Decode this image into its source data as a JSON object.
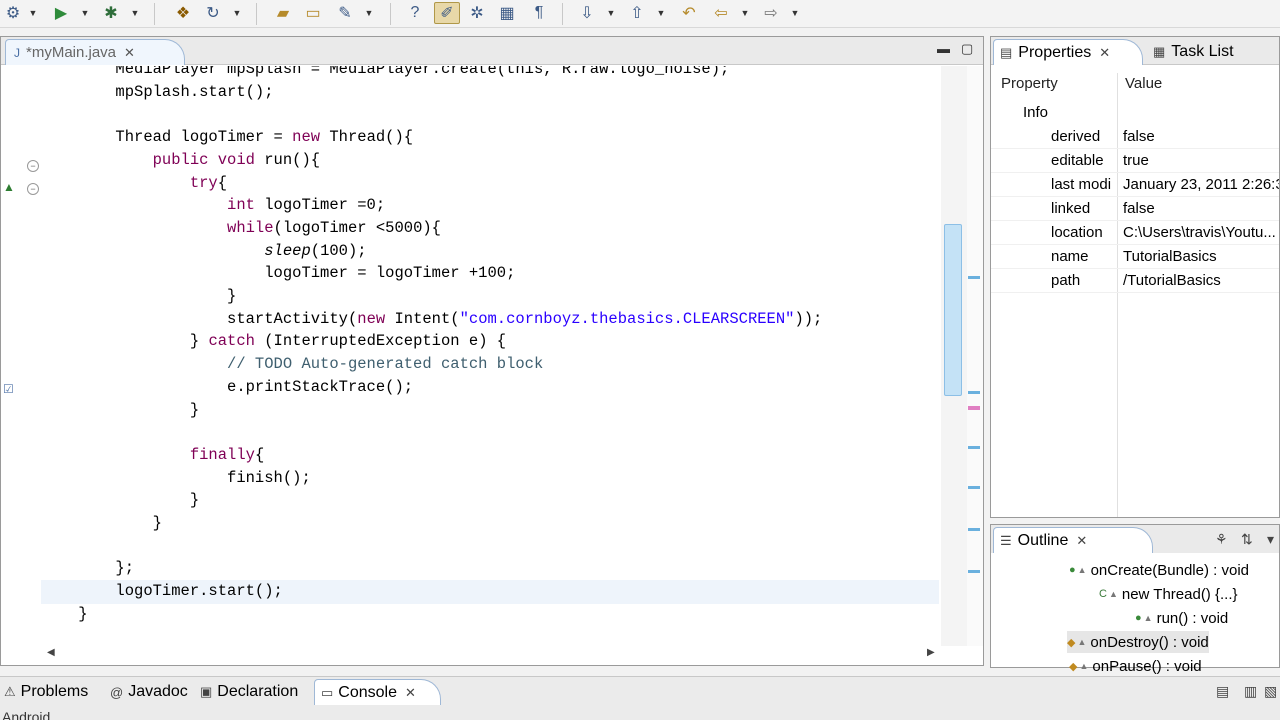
{
  "toolbar": {
    "buttons": [
      {
        "name": "settings-icon",
        "glyph": "⚙"
      },
      {
        "name": "run-icon",
        "glyph": "▶"
      },
      {
        "name": "debug-icon",
        "glyph": "✱"
      },
      {
        "name": "new-class-icon",
        "glyph": "❖"
      },
      {
        "name": "refresh-icon",
        "glyph": "↻"
      },
      {
        "name": "open-folder-icon",
        "glyph": "▰"
      },
      {
        "name": "open-file-icon",
        "glyph": "▭"
      },
      {
        "name": "edit-icon",
        "glyph": "✎"
      },
      {
        "name": "help-icon",
        "glyph": "?"
      },
      {
        "name": "highlight-icon",
        "glyph": "✐"
      },
      {
        "name": "mark-icon",
        "glyph": "✲"
      },
      {
        "name": "block-icon",
        "glyph": "▦"
      },
      {
        "name": "paragraph-icon",
        "glyph": "¶"
      },
      {
        "name": "next-annotation-icon",
        "glyph": "⇩"
      },
      {
        "name": "prev-annotation-icon",
        "glyph": "⇧"
      },
      {
        "name": "last-edit-icon",
        "glyph": "↶"
      },
      {
        "name": "back-icon",
        "glyph": "⇦"
      },
      {
        "name": "forward-icon",
        "glyph": "⇨"
      }
    ]
  },
  "editor": {
    "tab": {
      "title": "*myMain.java",
      "icon": "java-file-icon"
    },
    "code_lines": [
      {
        "indent": 0,
        "parts": [
          [
            "plain",
            "        MediaPlayer mpSplash = MediaPlayer.create(this, R.raw.logo_noise);"
          ]
        ]
      },
      {
        "indent": 0,
        "parts": [
          [
            "plain",
            "        mpSplash.start();"
          ]
        ]
      },
      {
        "indent": 0,
        "parts": [
          [
            "plain",
            ""
          ]
        ]
      },
      {
        "indent": 0,
        "parts": [
          [
            "plain",
            "        Thread logoTimer = "
          ],
          [
            "kw",
            "new"
          ],
          [
            "plain",
            " Thread(){"
          ]
        ]
      },
      {
        "indent": 0,
        "parts": [
          [
            "plain",
            "            "
          ],
          [
            "kw",
            "public void"
          ],
          [
            "plain",
            " run(){"
          ]
        ]
      },
      {
        "indent": 0,
        "parts": [
          [
            "plain",
            "                "
          ],
          [
            "kw",
            "try"
          ],
          [
            "plain",
            "{"
          ]
        ]
      },
      {
        "indent": 0,
        "parts": [
          [
            "plain",
            "                    "
          ],
          [
            "kw",
            "int"
          ],
          [
            "plain",
            " logoTimer =0;"
          ]
        ]
      },
      {
        "indent": 0,
        "parts": [
          [
            "plain",
            "                    "
          ],
          [
            "kw",
            "while"
          ],
          [
            "plain",
            "(logoTimer <5000){"
          ]
        ]
      },
      {
        "indent": 0,
        "parts": [
          [
            "plain",
            "                        "
          ],
          [
            "ital",
            "sleep"
          ],
          [
            "plain",
            "(100);"
          ]
        ]
      },
      {
        "indent": 0,
        "parts": [
          [
            "plain",
            "                        logoTimer = logoTimer +100;"
          ]
        ]
      },
      {
        "indent": 0,
        "parts": [
          [
            "plain",
            "                    }"
          ]
        ]
      },
      {
        "indent": 0,
        "parts": [
          [
            "plain",
            "                    startActivity("
          ],
          [
            "kw",
            "new"
          ],
          [
            "plain",
            " Intent("
          ],
          [
            "str",
            "\"com.cornboyz.thebasics.CLEARSCREEN\""
          ],
          [
            "plain",
            "));"
          ]
        ]
      },
      {
        "indent": 0,
        "parts": [
          [
            "plain",
            "                } "
          ],
          [
            "kw",
            "catch"
          ],
          [
            "plain",
            " (InterruptedException e) {"
          ]
        ]
      },
      {
        "indent": 0,
        "parts": [
          [
            "cmt",
            "                    // TODO Auto-generated catch block"
          ]
        ]
      },
      {
        "indent": 0,
        "parts": [
          [
            "plain",
            "                    e.printStackTrace();"
          ]
        ]
      },
      {
        "indent": 0,
        "parts": [
          [
            "plain",
            "                }"
          ]
        ]
      },
      {
        "indent": 0,
        "parts": [
          [
            "plain",
            ""
          ]
        ]
      },
      {
        "indent": 0,
        "parts": [
          [
            "plain",
            "                "
          ],
          [
            "kw",
            "finally"
          ],
          [
            "plain",
            "{"
          ]
        ]
      },
      {
        "indent": 0,
        "parts": [
          [
            "plain",
            "                    finish();"
          ]
        ]
      },
      {
        "indent": 0,
        "parts": [
          [
            "plain",
            "                }"
          ]
        ]
      },
      {
        "indent": 0,
        "parts": [
          [
            "plain",
            "            }"
          ]
        ]
      },
      {
        "indent": 0,
        "parts": [
          [
            "plain",
            ""
          ]
        ]
      },
      {
        "indent": 0,
        "parts": [
          [
            "plain",
            "        };"
          ]
        ]
      },
      {
        "indent": 0,
        "parts": [
          [
            "plain",
            "        logoTimer.start();"
          ]
        ]
      },
      {
        "indent": 0,
        "parts": [
          [
            "plain",
            "    }"
          ]
        ]
      }
    ]
  },
  "properties": {
    "tab_label": "Properties",
    "tab2_label": "Task List",
    "col_property": "Property",
    "col_value": "Value",
    "group": "Info",
    "rows": [
      {
        "name": "derived",
        "value": "false"
      },
      {
        "name": "editable",
        "value": "true"
      },
      {
        "name": "last modi",
        "value": "January 23, 2011 2:26:3"
      },
      {
        "name": "linked",
        "value": "false"
      },
      {
        "name": "location",
        "value": "C:\\Users\\travis\\Youtu..."
      },
      {
        "name": "name",
        "value": "TutorialBasics"
      },
      {
        "name": "path",
        "value": "/TutorialBasics"
      }
    ]
  },
  "outline": {
    "tab_label": "Outline",
    "items": [
      {
        "label": "onCreate(Bundle) : void"
      },
      {
        "label": "new Thread() {...}"
      },
      {
        "label": "run() : void"
      },
      {
        "label": "onDestroy() : void"
      },
      {
        "label": "onPause() : void"
      }
    ]
  },
  "bottom": {
    "tabs": [
      {
        "label": "Problems"
      },
      {
        "label": "Javadoc"
      },
      {
        "label": "Declaration"
      },
      {
        "label": "Console"
      }
    ],
    "console_label": "Android"
  }
}
